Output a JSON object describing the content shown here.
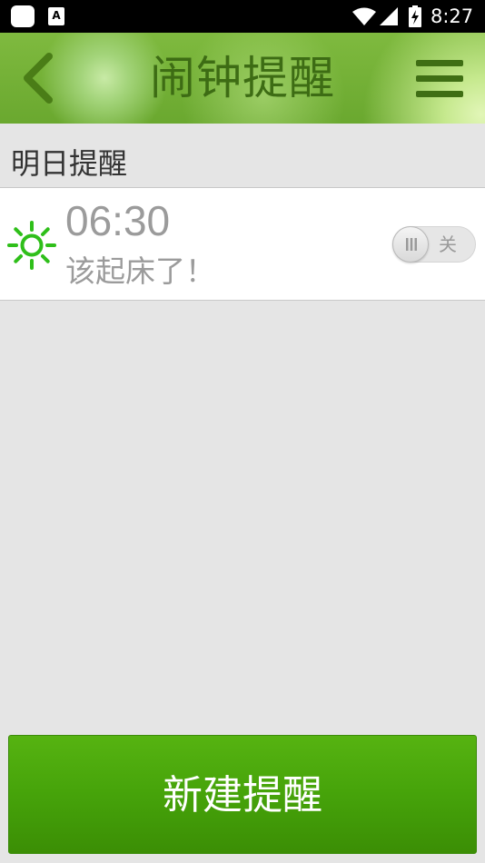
{
  "status_bar": {
    "time": "8:27",
    "a_icon_letter": "A",
    "icons": [
      "app-icon",
      "a-text-icon",
      "wifi-icon",
      "signal-icon",
      "battery-charging-icon"
    ]
  },
  "header": {
    "title": "闹钟提醒",
    "back_icon": "chevron-left-icon",
    "menu_icon": "hamburger-menu-icon"
  },
  "section": {
    "title": "明日提醒"
  },
  "alarm": {
    "icon": "sun-icon",
    "time": "06:30",
    "label": "该起床了！",
    "toggle_state_label": "关",
    "enabled": false
  },
  "footer": {
    "new_button_label": "新建提醒"
  },
  "colors": {
    "accent_green": "#4aa80d",
    "title_green": "#3d6c14",
    "sun_green": "#2fbf1a",
    "background": "#e5e5e5"
  }
}
